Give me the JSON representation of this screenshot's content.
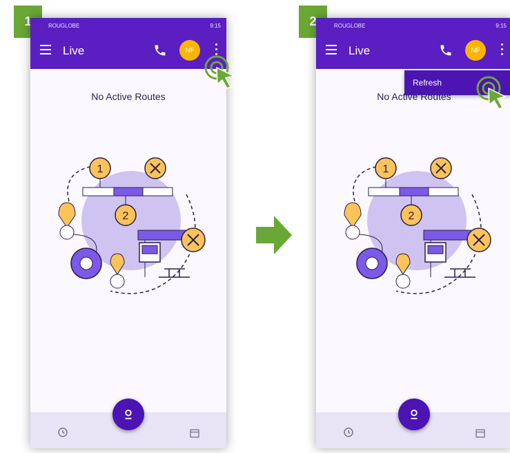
{
  "steps": {
    "first": "1",
    "second": "2"
  },
  "status": {
    "carrier": "ROUGLOBE",
    "time": "9:15"
  },
  "appbar": {
    "title": "Live",
    "avatar_initials": "NF"
  },
  "main": {
    "empty_title": "No Active Routes"
  },
  "menu": {
    "refresh_label": "Refresh"
  },
  "colors": {
    "primary": "#5b1ec2",
    "accent": "#f9b500",
    "step_badge": "#6aa836"
  },
  "icons": [
    "hamburger-menu-icon",
    "phone-icon",
    "more-vert-icon",
    "history-icon",
    "route-pin-icon",
    "calendar-icon",
    "tap-cursor-icon",
    "right-arrow-icon"
  ]
}
